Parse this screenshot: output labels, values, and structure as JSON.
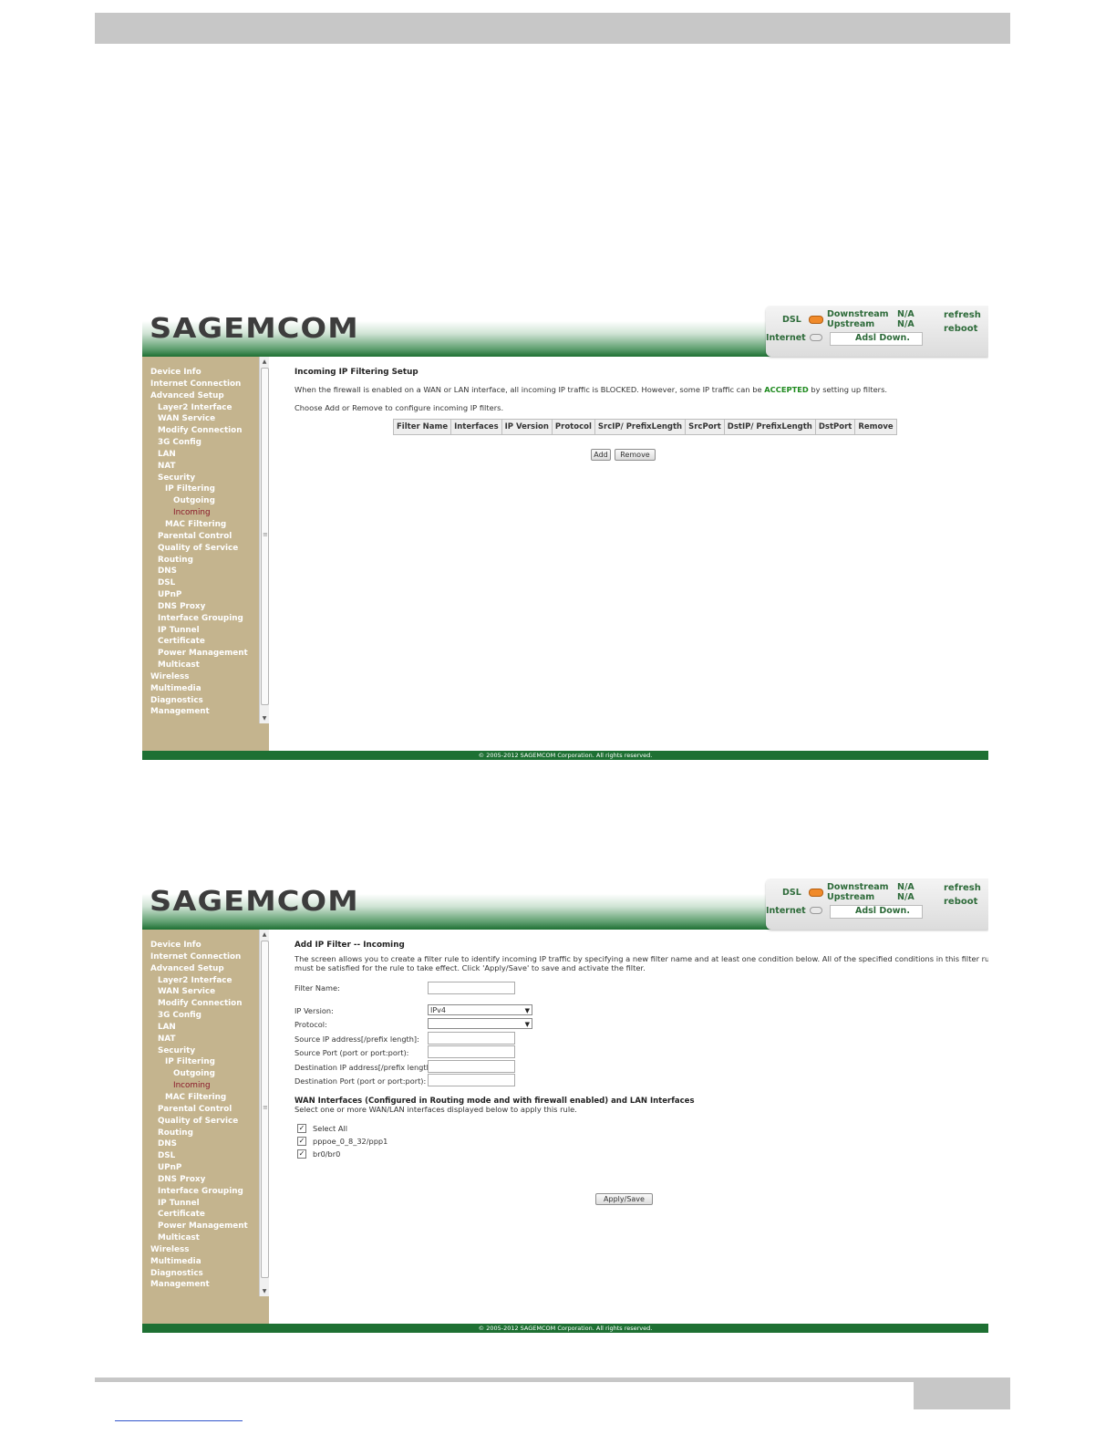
{
  "brand": {
    "logo_text": "SAGEMCOM"
  },
  "status": {
    "dsl_label": "DSL",
    "downstream_label": "Downstream",
    "upstream_label": "Upstream",
    "downstream_value": "N/A",
    "upstream_value": "N/A",
    "internet_label": "Internet",
    "adsl_status": "Adsl Down.",
    "refresh_label": "refresh",
    "reboot_label": "reboot",
    "dsl_led_color": "#f08a2a"
  },
  "nav": [
    {
      "label": "Device Info",
      "level": 0
    },
    {
      "label": "Internet Connection",
      "level": 0
    },
    {
      "label": "Advanced Setup",
      "level": 0
    },
    {
      "label": "Layer2 Interface",
      "level": 1
    },
    {
      "label": "WAN Service",
      "level": 1
    },
    {
      "label": "Modify Connection",
      "level": 1
    },
    {
      "label": "3G Config",
      "level": 1
    },
    {
      "label": "LAN",
      "level": 1
    },
    {
      "label": "NAT",
      "level": 1
    },
    {
      "label": "Security",
      "level": 1
    },
    {
      "label": "IP Filtering",
      "level": 2
    },
    {
      "label": "Outgoing",
      "level": 3
    },
    {
      "label": "Incoming",
      "level": 3,
      "active": true
    },
    {
      "label": "MAC Filtering",
      "level": 2
    },
    {
      "label": "Parental Control",
      "level": 1
    },
    {
      "label": "Quality of Service",
      "level": 1
    },
    {
      "label": "Routing",
      "level": 1
    },
    {
      "label": "DNS",
      "level": 1
    },
    {
      "label": "DSL",
      "level": 1
    },
    {
      "label": "UPnP",
      "level": 1
    },
    {
      "label": "DNS Proxy",
      "level": 1
    },
    {
      "label": "Interface Grouping",
      "level": 1
    },
    {
      "label": "IP Tunnel",
      "level": 1
    },
    {
      "label": "Certificate",
      "level": 1
    },
    {
      "label": "Power Management",
      "level": 1
    },
    {
      "label": "Multicast",
      "level": 1
    },
    {
      "label": "Wireless",
      "level": 0
    },
    {
      "label": "Multimedia",
      "level": 0
    },
    {
      "label": "Diagnostics",
      "level": 0
    },
    {
      "label": "Management",
      "level": 0
    }
  ],
  "footer_text": "© 2005-2012 SAGEMCOM Corporation. All rights reserved.",
  "shot1": {
    "title": "Incoming IP Filtering Setup",
    "desc_before": "When the firewall is enabled on a WAN or LAN interface, all incoming IP traffic is BLOCKED. However, some IP traffic can be ",
    "desc_accepted": "ACCEPTED",
    "desc_after": " by setting up filters.",
    "instruction": "Choose Add or Remove to configure incoming IP filters.",
    "columns": [
      "Filter Name",
      "Interfaces",
      "IP Version",
      "Protocol",
      "SrcIP/ PrefixLength",
      "SrcPort",
      "DstIP/ PrefixLength",
      "DstPort",
      "Remove"
    ],
    "add_label": "Add",
    "remove_label": "Remove"
  },
  "shot2": {
    "title": "Add IP Filter -- Incoming",
    "desc_line1": "The screen allows you to create a filter rule to identify incoming IP traffic by specifying a new filter name and at least one condition below. All of the specified conditions in this filter rule",
    "desc_line2": "must be satisfied for the rule to take effect. Click 'Apply/Save' to save and activate the filter.",
    "filter_name_label": "Filter Name:",
    "filter_name_value": "",
    "ip_version_label": "IP Version:",
    "ip_version_value": "IPv4",
    "protocol_label": "Protocol:",
    "protocol_value": "",
    "src_ip_label": "Source IP address[/prefix length]:",
    "src_port_label": "Source Port (port or port:port):",
    "dst_ip_label": "Destination IP address[/prefix length]:",
    "dst_port_label": "Destination Port (port or port:port):",
    "wan_title": "WAN Interfaces (Configured in Routing mode and with firewall enabled) and LAN Interfaces",
    "wan_desc": "Select one or more WAN/LAN interfaces displayed below to apply this rule.",
    "interfaces": [
      {
        "label": "Select All",
        "checked": true
      },
      {
        "label": "pppoe_0_8_32/ppp1",
        "checked": true
      },
      {
        "label": "br0/br0",
        "checked": true
      }
    ],
    "apply_label": "Apply/Save"
  }
}
